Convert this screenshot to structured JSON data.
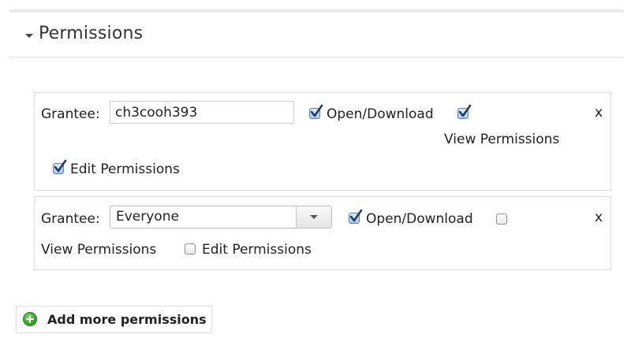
{
  "section": {
    "title": "Permissions"
  },
  "permissions": [
    {
      "grantee_label": "Grantee:",
      "grantee_value": "ch3cooh393",
      "open_download_label": "Open/Download",
      "open_download_checked": true,
      "view_permissions_label": "View Permissions",
      "view_permissions_checked": true,
      "edit_permissions_label": "Edit Permissions",
      "edit_permissions_checked": true,
      "remove_label": "x"
    },
    {
      "grantee_label": "Grantee:",
      "grantee_value": "Everyone",
      "open_download_label": "Open/Download",
      "open_download_checked": true,
      "view_permissions_label": "View Permissions",
      "view_permissions_checked": false,
      "edit_permissions_label": "Edit Permissions",
      "edit_permissions_checked": false,
      "remove_label": "x"
    }
  ],
  "add_button": {
    "label": "Add more permissions",
    "icon": "add-circle-icon"
  },
  "colors": {
    "add_icon_green": "#2f9a24",
    "checkbox_checked": "#aec8e6"
  }
}
